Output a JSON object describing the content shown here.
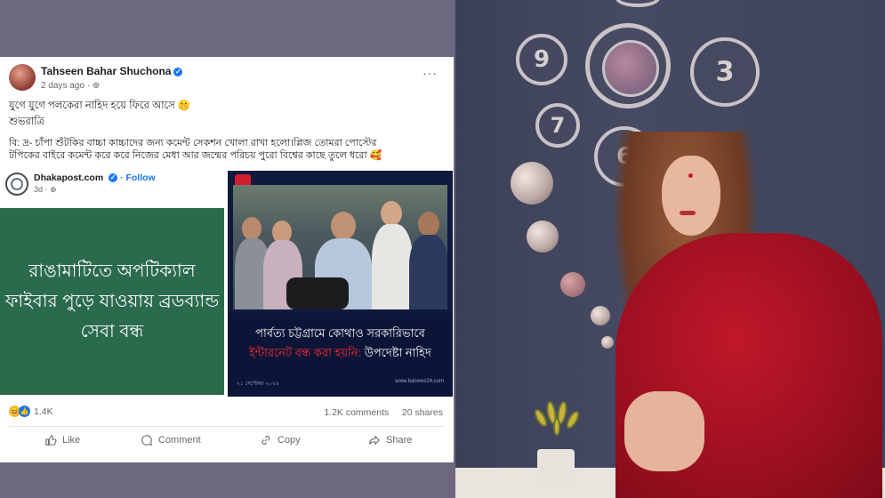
{
  "post": {
    "author": "Tahseen Bahar Shuchona",
    "time": "2 days ago · ",
    "line1": "যুগে যুগে পলকেরা নাহিদ হয়ে ফিরে আসে 🤫",
    "line2": "শুভরাত্রি",
    "line3": "বি: দ্র- চাঁপা শুঁটকির বাচ্চা কাচ্চাদের জন্য কমেন্ট সেকশন খোলা রাখা হলো।প্লিজ তোমরা পোস্টের",
    "line4": "টপিকের বাইরে কমেন্ট করে করে নিজের মেধা আর জন্মের পরিচয় পুরো বিশ্বের কাছে তুলে ধরো 🥰"
  },
  "shared": {
    "page_name": "Dhakapost.com",
    "follow": "Follow",
    "meta": "3d · ",
    "card_text_1": "রাঙামাটিতে অপটিক্যাল",
    "card_text_2": "ফাইবার পুড়ে যাওয়ায় ব্রডব্যান্ড",
    "card_text_3": "সেবা বন্ধ"
  },
  "news": {
    "line1": "পার্বত্য চট্টগ্রামে কোথাও সরকারিভাবে",
    "line2_red": "ইন্টারনেট বন্ধ করা হয়নি:",
    "line2_white": " উপদেষ্টা নাহিদ",
    "foot_left": "২১ সেপ্টেম্বর ২০২৪",
    "foot_right": "www.banews24.com"
  },
  "stats": {
    "reactions": "1.4K",
    "comments": "1.2K comments",
    "shares": "20 shares"
  },
  "actions": {
    "like": "Like",
    "comment": "Comment",
    "copy": "Copy",
    "share": "Share"
  },
  "clock": {
    "n9": "9",
    "n3": "3",
    "n7": "7",
    "n6": "6"
  },
  "colors": {
    "fb_blue": "#1877f2",
    "green_card": "#2b6b4d",
    "saree_red": "#b3121f"
  }
}
